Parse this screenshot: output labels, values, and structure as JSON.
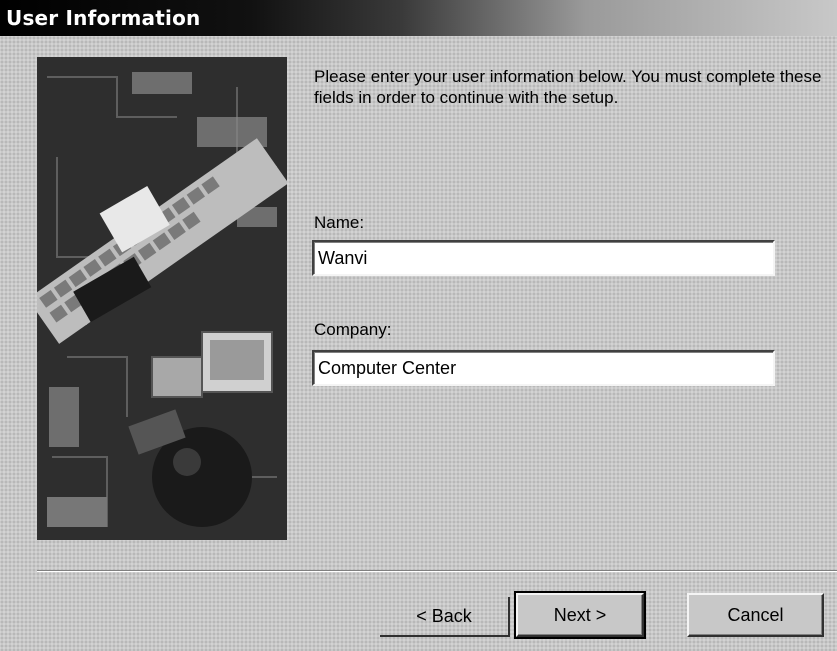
{
  "window": {
    "title": "User Information"
  },
  "main": {
    "instruction": "Please enter your user information below.  You must complete these fields in order to continue with the setup.",
    "name_label": "Name:",
    "name_value": "Wanvi",
    "company_label": "Company:",
    "company_value": "Computer Center"
  },
  "buttons": {
    "back_label": "< Back",
    "next_label": "Next >",
    "cancel_label": "Cancel"
  },
  "colors": {
    "dialog_background": "#c8c8c8",
    "titlebar_start": "#000000",
    "titlebar_end": "#c8c8c8",
    "field_background": "#ffffff"
  },
  "icons": {
    "side_image": "computer-hardware-collage-image"
  }
}
